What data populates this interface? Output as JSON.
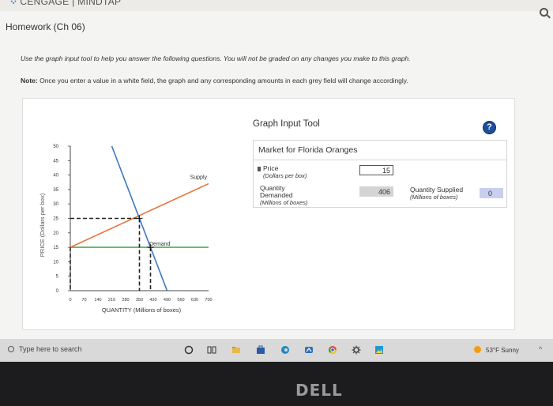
{
  "header": {
    "brand": "CENGAGE | MINDTAP"
  },
  "page": {
    "title": "Homework (Ch 06)",
    "instruction": "Use the graph input tool to help you answer the following questions. You will not be graded on any changes you make to this graph.",
    "note_label": "Note:",
    "note_text": " Once you enter a value in a white field, the graph and any corresponding amounts in each grey field will change accordingly."
  },
  "chart_data": {
    "type": "line",
    "title": "",
    "xlabel": "QUANTITY (Millions of boxes)",
    "ylabel": "PRICE (Dollars per box)",
    "xlim": [
      0,
      700
    ],
    "ylim": [
      0,
      50
    ],
    "x_ticks": [
      0,
      70,
      140,
      210,
      280,
      350,
      420,
      490,
      560,
      630,
      700
    ],
    "y_ticks": [
      0,
      5,
      10,
      15,
      20,
      25,
      30,
      35,
      40,
      45,
      50
    ],
    "grid": false,
    "series": [
      {
        "name": "Supply",
        "color": "#e8743b",
        "x": [
          0,
          700
        ],
        "y": [
          15,
          37
        ]
      },
      {
        "name": "Demand",
        "color": "#3a78c3",
        "x": [
          210,
          490
        ],
        "y": [
          50,
          0
        ]
      }
    ],
    "reference_lines": [
      {
        "color": "#4caf50",
        "x": [
          0,
          700
        ],
        "y": [
          15,
          15
        ]
      }
    ],
    "markers": [
      {
        "x": 350,
        "y": 25
      },
      {
        "x": 406,
        "y": 15
      }
    ]
  },
  "tool": {
    "title": "Graph Input Tool",
    "help_label": "?",
    "market_title": "Market for Florida Oranges",
    "price_label": "Price",
    "price_unit": "(Dollars per box)",
    "price_value": "15",
    "qd_label_1": "Quantity",
    "qd_label_2": "Demanded",
    "qd_unit": "(Millions of boxes)",
    "qd_value": "406",
    "qs_label": "Quantity Supplied",
    "qs_unit": "(Millions of boxes)",
    "qs_value": "0"
  },
  "taskbar": {
    "search_placeholder": "Type here to search",
    "weather": "53°F  Sunny"
  },
  "bezel": {
    "logo": "DELL"
  }
}
